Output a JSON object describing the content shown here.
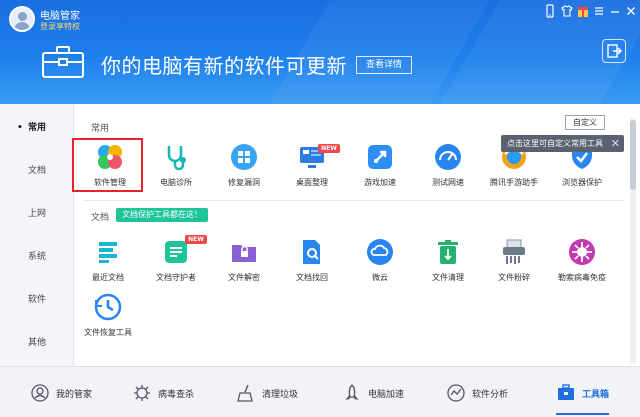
{
  "titlebar": {
    "app_name": "电脑管家",
    "login_link": "登录享特权"
  },
  "banner": {
    "message": "你的电脑有新的软件可更新",
    "details_button": "查看详情"
  },
  "sidebar": {
    "items": [
      {
        "label": "常用",
        "active": true
      },
      {
        "label": "文档",
        "active": false
      },
      {
        "label": "上网",
        "active": false
      },
      {
        "label": "系统",
        "active": false
      },
      {
        "label": "软件",
        "active": false
      },
      {
        "label": "其他",
        "active": false
      }
    ]
  },
  "sections": {
    "common": {
      "title": "常用",
      "tools": [
        {
          "label": "软件管理",
          "selected": true
        },
        {
          "label": "电脑诊所"
        },
        {
          "label": "修复漏洞"
        },
        {
          "label": "桌面整理",
          "badge": "NEW"
        },
        {
          "label": "游戏加速"
        },
        {
          "label": "测试网速"
        },
        {
          "label": "腾讯手游助手"
        },
        {
          "label": "浏览器保护"
        }
      ]
    },
    "documents": {
      "title": "文档",
      "tag": "文档保护工具都在这！",
      "tools": [
        {
          "label": "最近文档"
        },
        {
          "label": "文档守护者",
          "badge": "NEW"
        },
        {
          "label": "文件解密"
        },
        {
          "label": "文档找回"
        },
        {
          "label": "微云"
        },
        {
          "label": "文件清理"
        },
        {
          "label": "文件粉碎"
        },
        {
          "label": "勒索病毒免疫"
        },
        {
          "label": "文件恢复工具"
        }
      ]
    }
  },
  "customize": {
    "button": "自定义",
    "tooltip": "点击这里可自定义常用工具"
  },
  "bottom_nav": {
    "items": [
      {
        "label": "我的管家"
      },
      {
        "label": "病毒查杀"
      },
      {
        "label": "清理垃圾"
      },
      {
        "label": "电脑加速"
      },
      {
        "label": "软件分析"
      },
      {
        "label": "工具箱",
        "active": true
      }
    ]
  },
  "colors": {
    "header_blue": "#1f80ec",
    "accent_blue": "#1f6fe0",
    "selection_red": "#e8212a",
    "tag_green": "#1ec49a",
    "badge_red": "#f04848"
  }
}
